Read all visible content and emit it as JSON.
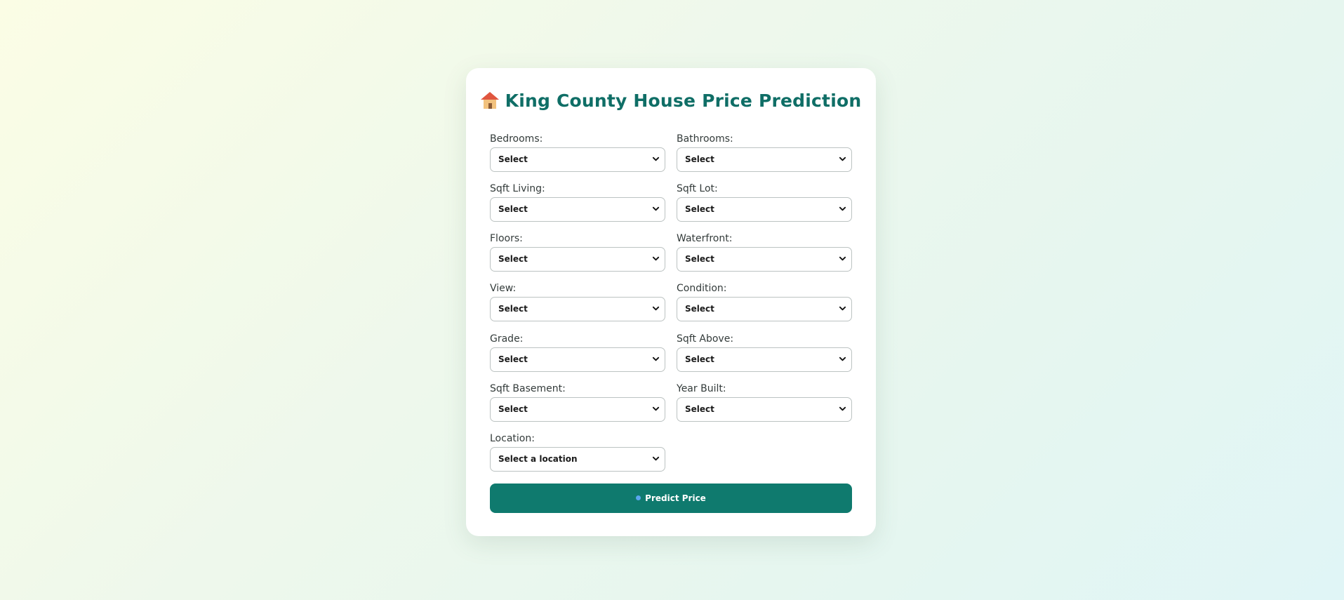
{
  "page": {
    "title": "King County House Price Prediction",
    "title_icon": "house-emoji-icon",
    "accent_color": "#0f7a6e"
  },
  "form": {
    "bedrooms": {
      "label": "Bedrooms:",
      "value": "Select"
    },
    "bathrooms": {
      "label": "Bathrooms:",
      "value": "Select"
    },
    "sqft_living": {
      "label": "Sqft Living:",
      "value": "Select"
    },
    "sqft_lot": {
      "label": "Sqft Lot:",
      "value": "Select"
    },
    "floors": {
      "label": "Floors:",
      "value": "Select"
    },
    "waterfront": {
      "label": "Waterfront:",
      "value": "Select"
    },
    "view": {
      "label": "View:",
      "value": "Select"
    },
    "condition": {
      "label": "Condition:",
      "value": "Select"
    },
    "grade": {
      "label": "Grade:",
      "value": "Select"
    },
    "sqft_above": {
      "label": "Sqft Above:",
      "value": "Select"
    },
    "sqft_basement": {
      "label": "Sqft Basement:",
      "value": "Select"
    },
    "year_built": {
      "label": "Year Built:",
      "value": "Select"
    },
    "location": {
      "label": "Location:",
      "value": "Select a location"
    },
    "submit_label": "Predict Price",
    "submit_icon": "blue-circle-icon"
  }
}
